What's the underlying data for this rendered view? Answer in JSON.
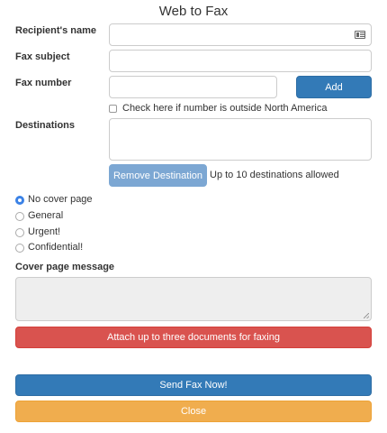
{
  "title": "Web to Fax",
  "recipient": {
    "label": "Recipient's name",
    "value": "",
    "icon": "contact-card-icon"
  },
  "subject": {
    "label": "Fax subject",
    "value": ""
  },
  "fax_number": {
    "label": "Fax number",
    "value": "",
    "add_label": "Add"
  },
  "outside_na": {
    "label": "Check here if number is outside North America",
    "checked": false
  },
  "destinations": {
    "label": "Destinations",
    "remove_label": "Remove Destination",
    "limit_text": "Up to 10 destinations allowed"
  },
  "cover_options": [
    {
      "label": "No cover page",
      "selected": true
    },
    {
      "label": "General",
      "selected": false
    },
    {
      "label": "Urgent!",
      "selected": false
    },
    {
      "label": "Confidential!",
      "selected": false
    }
  ],
  "cover_message": {
    "label": "Cover page message",
    "value": ""
  },
  "attach_label": "Attach up to three documents for faxing",
  "send_label": "Send Fax Now!",
  "close_label": "Close",
  "colors": {
    "primary": "#337ab7",
    "primary_disabled": "#7ca7d3",
    "danger": "#d9534f",
    "warning": "#f0ad4e",
    "radio_selected": "#3b82e6"
  }
}
